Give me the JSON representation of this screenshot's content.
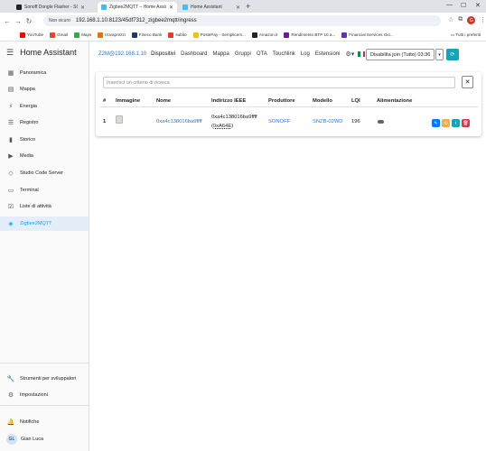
{
  "browser": {
    "tabs": [
      {
        "title": "Sonoff Dongle Flasher - SONOFF",
        "active": false
      },
      {
        "title": "Zigbee2MQTT – Home Assistant",
        "active": true
      },
      {
        "title": "Home Assistant",
        "active": false
      }
    ],
    "url_security": "Non sicuro",
    "url": "192.168.1.10:8123/45df7312_zigbee2mqtt/ingress",
    "profile_initial": "G",
    "bookmarks": [
      "YouTube",
      "Gmail",
      "Maps",
      "trovaprezzi",
      "Fineco Bank",
      "subito",
      "PostePay - Semplicem...",
      "Amazon.it",
      "Rendimento BTP 10 a...",
      "Financial Services Gio..."
    ],
    "bookmarks_folder": "Tutti i preferiti"
  },
  "sidebar": {
    "title": "Home Assistant",
    "items": [
      {
        "label": "Panoramica",
        "icon": "dashboard-icon",
        "glyph": "▦"
      },
      {
        "label": "Mappa",
        "icon": "map-icon",
        "glyph": "▤"
      },
      {
        "label": "Energia",
        "icon": "energy-icon",
        "glyph": "⚡"
      },
      {
        "label": "Registro",
        "icon": "logbook-icon",
        "glyph": "☰"
      },
      {
        "label": "Storico",
        "icon": "history-icon",
        "glyph": "▮"
      },
      {
        "label": "Media",
        "icon": "media-icon",
        "glyph": "▶"
      },
      {
        "label": "Studio Code Server",
        "icon": "code-icon",
        "glyph": "◇"
      },
      {
        "label": "Terminal",
        "icon": "terminal-icon",
        "glyph": "▭"
      },
      {
        "label": "Liste di attività",
        "icon": "todo-icon",
        "glyph": "☑"
      },
      {
        "label": "Zigbee2MQTT",
        "icon": "zigbee-icon",
        "glyph": "◈"
      }
    ],
    "bottom": [
      {
        "label": "Strumenti per sviluppatori",
        "icon": "wrench-icon",
        "glyph": "🔧"
      },
      {
        "label": "Impostazioni",
        "icon": "gear-icon",
        "glyph": "⚙"
      },
      {
        "label": "Notifiche",
        "icon": "bell-icon",
        "glyph": "🔔"
      }
    ],
    "user": {
      "initials": "GL",
      "name": "Gian Luca"
    }
  },
  "z2m": {
    "host": "Z2M@192.168.1.10",
    "nav": [
      "Dispositivi",
      "Dashboard",
      "Mappa",
      "Gruppi",
      "OTA",
      "Touchlink",
      "Log",
      "Estensioni"
    ],
    "join_button": "Disabilita join (Tutto) 03:36",
    "search_placeholder": "Inserisci un criterio di ricerca",
    "columns": [
      "#",
      "Immagine",
      "Nome",
      "Indirizzo IEEE",
      "Produttore",
      "Modello",
      "LQI",
      "Alimentazione"
    ],
    "rows": [
      {
        "index": "1",
        "name": "0xa4c138016ba9ffff",
        "ieee": "0xa4c138016ba9ffff",
        "nwk": "(0xA64E)",
        "manufacturer": "SONOFF",
        "model": "SNZB-02WD",
        "lqi": "196"
      }
    ]
  },
  "colors": {
    "accent": "#03a9f4",
    "link": "#3578c6",
    "btn_rename": "#007bff",
    "btn_configure": "#f0ad4e",
    "btn_info": "#17a2b8",
    "btn_delete": "#dc3545"
  }
}
